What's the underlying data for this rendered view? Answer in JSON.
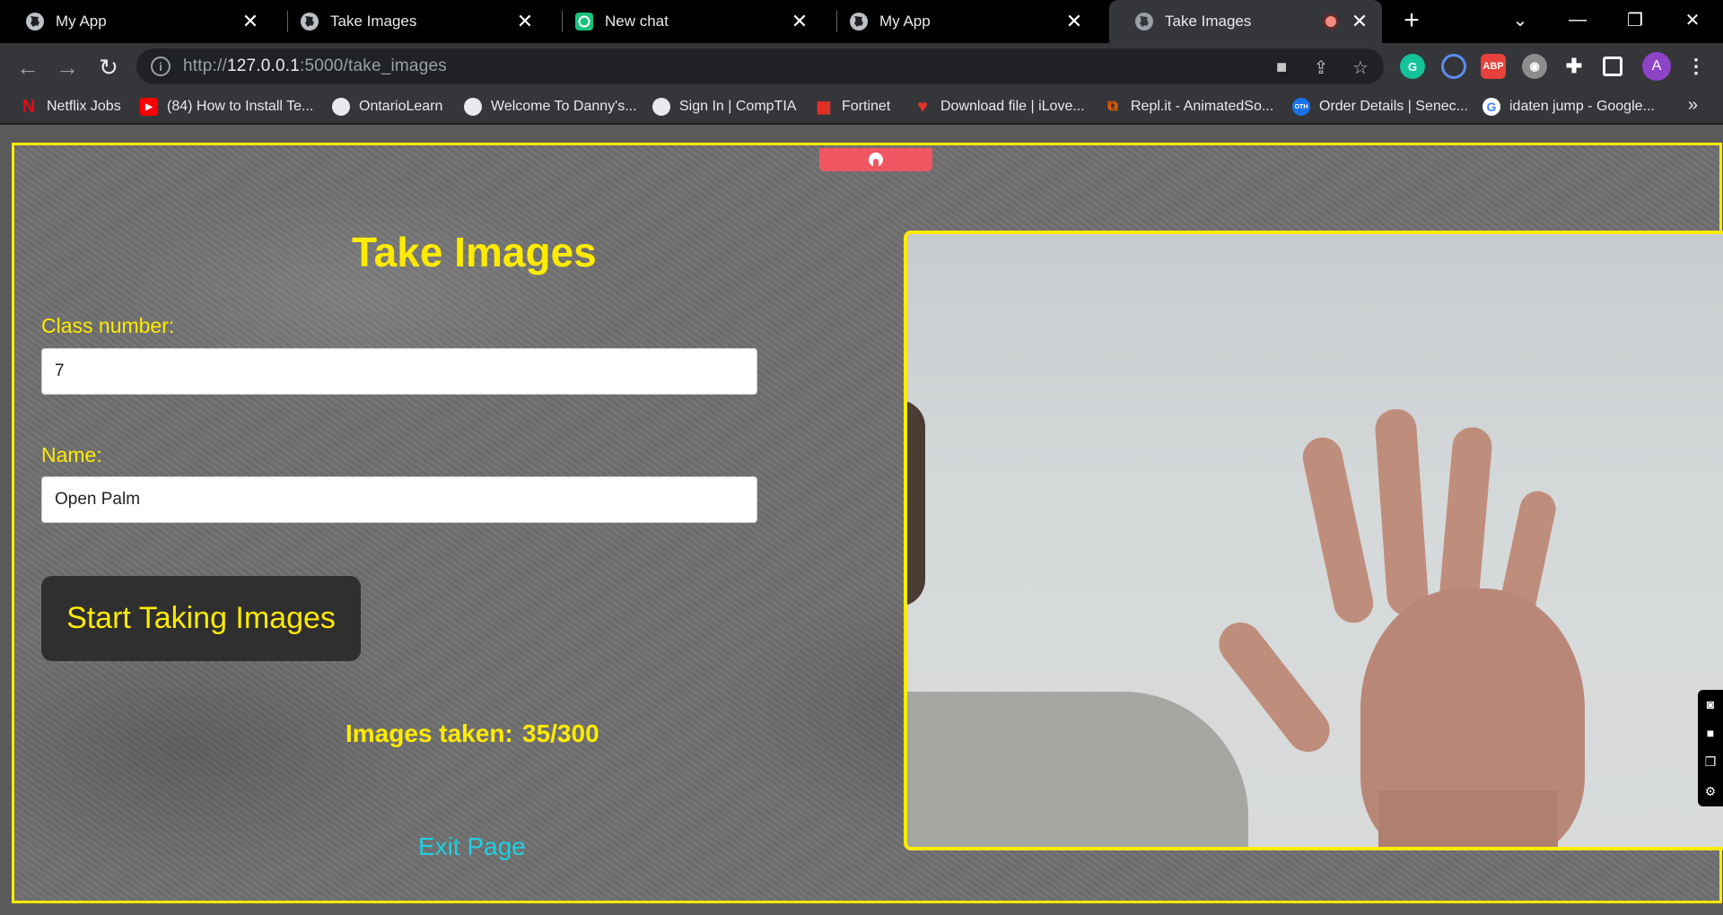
{
  "tabs": [
    {
      "title": "My App",
      "icon": "globe-icon"
    },
    {
      "title": "Take Images",
      "icon": "globe-icon"
    },
    {
      "title": "New chat",
      "icon": "chatgpt-icon"
    },
    {
      "title": "My App",
      "icon": "globe-icon"
    },
    {
      "title": "Take Images",
      "icon": "globe-icon",
      "active": true,
      "recording": true
    }
  ],
  "toolbar": {
    "url_prefix": "http://",
    "url_host": "127.0.0.1",
    "url_rest": ":5000/take_images"
  },
  "profile_initial": "A",
  "bookmarks": [
    {
      "label": "Netflix Jobs",
      "icon": "netflix-icon"
    },
    {
      "label": "(84) How to Install Te...",
      "icon": "youtube-icon"
    },
    {
      "label": "OntarioLearn",
      "icon": "globe-icon"
    },
    {
      "label": "Welcome To Danny's...",
      "icon": "globe-icon"
    },
    {
      "label": "Sign In | CompTIA",
      "icon": "globe-icon"
    },
    {
      "label": "Fortinet",
      "icon": "fortinet-icon"
    },
    {
      "label": "Download file | iLove...",
      "icon": "heart-icon"
    },
    {
      "label": "Repl.it - AnimatedSo...",
      "icon": "replit-icon"
    },
    {
      "label": "Order Details | Senec...",
      "icon": "oth-icon"
    },
    {
      "label": "idaten jump - Google...",
      "icon": "google-icon"
    }
  ],
  "page": {
    "heading": "Take Images",
    "class_label": "Class number:",
    "class_value": "7",
    "name_label": "Name:",
    "name_value": "Open Palm",
    "start_button": "Start Taking Images",
    "counter_label": "Images taken:",
    "counter_value": "35/300",
    "images_taken": 35,
    "images_total": 300,
    "exit_link": "Exit Page"
  },
  "colors": {
    "accent": "#ffeb00",
    "link": "#1fd0e0",
    "button_bg": "#2f2f2f",
    "recording_pill": "#ef5662"
  }
}
